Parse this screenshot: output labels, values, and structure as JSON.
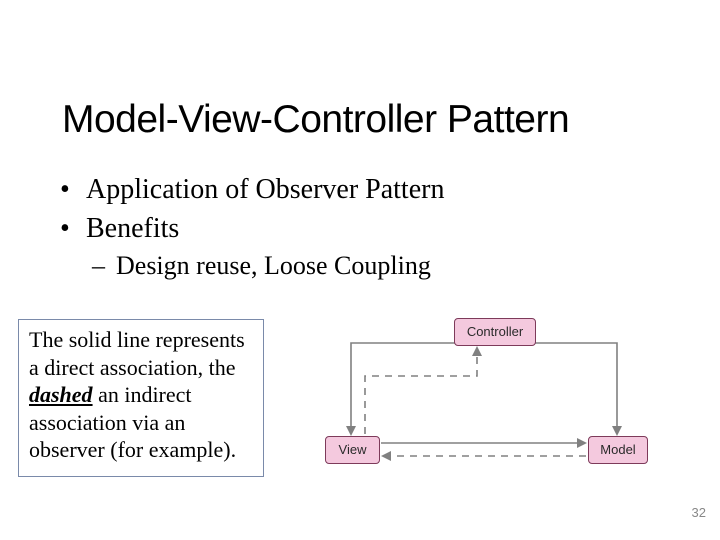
{
  "title": "Model-View-Controller Pattern",
  "bullets": {
    "b1": "Application of Observer Pattern",
    "b2": "Benefits",
    "b2a": "Design reuse, Loose Coupling"
  },
  "callout": {
    "part1": "The solid line represents a direct association, the ",
    "dashed_word": "dashed",
    "part2": " an indirect association via an observer (for example)."
  },
  "diagram": {
    "controller": "Controller",
    "view": "View",
    "model": "Model"
  },
  "page_number": "32"
}
